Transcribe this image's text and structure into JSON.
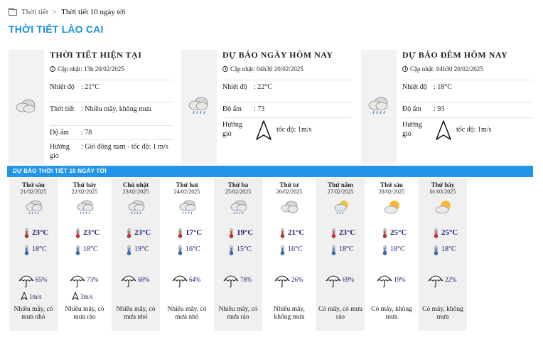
{
  "breadcrumb": {
    "home": "Thời tiết",
    "current": "Thời tiết 10 ngày tới"
  },
  "page_title": "THỜI TIẾT LÀO CAI",
  "current": {
    "title": "THỜI TIẾT HIỆN TẠI",
    "updated": "Cập nhật: 13h 20/02/2025",
    "icon": "cloudy-icon",
    "temp_label": "Nhiệt độ",
    "temp_value": ": 21°C",
    "weather_label": "Thời tiết",
    "weather_value": ": Nhiều mây, không mưa",
    "humidity_label": "Độ ẩm",
    "humidity_value": ": 78",
    "wind_label": "Hướng gió",
    "wind_value": ": Gió đông nam - tốc độ: 1 m/s"
  },
  "today": {
    "title": "DỰ BÁO NGÀY HÔM NAY",
    "updated": "Cập nhật: 04h30 20/02/2025",
    "icon": "rain-cloud-icon",
    "temp_label": "Nhiệt độ",
    "temp_value": ": 22°C",
    "humidity_label": "Độ ẩm",
    "humidity_value": ": 73",
    "wind_label": "Hướng gió",
    "wind_value": "tốc độ: 1m/s"
  },
  "tonight": {
    "title": "DỰ BÁO ĐÊM HÔM NAY",
    "updated": "Cập nhật: 04h30 20/02/2025",
    "icon": "rain-cloud-icon",
    "temp_label": "Nhiệt độ",
    "temp_value": ": 18°C",
    "humidity_label": "Độ ẩm",
    "humidity_value": ": 93",
    "wind_label": "Hướng gió",
    "wind_value": "tốc độ: 1m/s"
  },
  "forecast": {
    "header": "DỰ BÁO THỜI TIẾT 10 NGÀY TỚI",
    "days": [
      {
        "name": "Thứ sáu",
        "date": "21/02/2025",
        "icon": "rain-cloud-icon",
        "high": "23°C",
        "low": "18°C",
        "rain": "65%",
        "wind": "1m/s",
        "desc": "Nhiều mây, có mưa nhỏ"
      },
      {
        "name": "Thứ bảy",
        "date": "22/02/2025",
        "icon": "rain-cloud-icon",
        "high": "23°C",
        "low": "18°C",
        "rain": "73%",
        "wind": "3m/s",
        "desc": "Nhiều mây, có mưa rào"
      },
      {
        "name": "Chủ nhật",
        "date": "23/02/2025",
        "icon": "rain-cloud-icon",
        "high": "23°C",
        "low": "19°C",
        "rain": "68%",
        "wind": "",
        "desc": "Nhiều mây, có mưa nhỏ"
      },
      {
        "name": "Thứ hai",
        "date": "24/02/2025",
        "icon": "rain-cloud-icon",
        "high": "17°C",
        "low": "16°C",
        "rain": "64%",
        "wind": "",
        "desc": "Nhiều mây, có mưa nhỏ"
      },
      {
        "name": "Thứ ba",
        "date": "25/02/2025",
        "icon": "rain-cloud-icon",
        "high": "19°C",
        "low": "15°C",
        "rain": "78%",
        "wind": "",
        "desc": "Nhiều mây, có mưa rào"
      },
      {
        "name": "Thứ tư",
        "date": "26/02/2025",
        "icon": "cloudy-icon",
        "high": "21°C",
        "low": "16°C",
        "rain": "26%",
        "wind": "",
        "desc": "Nhiều mây, không mưa"
      },
      {
        "name": "Thứ năm",
        "date": "27/02/2025",
        "icon": "sun-rain-icon",
        "high": "23°C",
        "low": "18°C",
        "rain": "69%",
        "wind": "",
        "desc": "Có mây, có mưa rào"
      },
      {
        "name": "Thứ sáu",
        "date": "28/02/2025",
        "icon": "partly-cloudy-icon",
        "high": "25°C",
        "low": "18°C",
        "rain": "19%",
        "wind": "",
        "desc": "Có mây, không mưa"
      },
      {
        "name": "Thứ bảy",
        "date": "01/03/2025",
        "icon": "partly-cloudy-icon",
        "high": "25°C",
        "low": "18°C",
        "rain": "22%",
        "wind": "",
        "desc": "Có mây, không mưa"
      }
    ]
  },
  "colors": {
    "accent": "#1a8fd8",
    "header_bar": "#2196e8",
    "temp_text": "#1a1a6e",
    "thermo_red": "#d9281c",
    "thermo_blue": "#2a6fd6"
  }
}
